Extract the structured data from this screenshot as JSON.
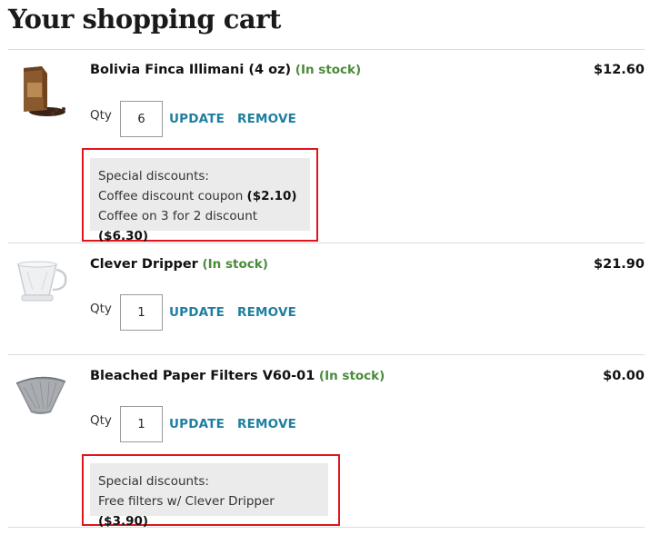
{
  "page": {
    "title": "Your shopping cart"
  },
  "cart": {
    "qty_label": "Qty",
    "update_label": "UPDATE",
    "remove_label": "REMOVE",
    "discount_heading": "Special discounts:",
    "items": [
      {
        "name": "Bolivia Finca Illimani (4 oz)",
        "stock": "(In stock)",
        "price": "$12.60",
        "qty": "6",
        "image_icon": "coffee-bag-icon",
        "discounts": [
          {
            "label": "Coffee discount coupon",
            "amount": "($2.10)"
          },
          {
            "label": "Coffee on 3 for 2 discount",
            "amount": "($6.30)"
          }
        ]
      },
      {
        "name": "Clever Dripper",
        "stock": "(In stock)",
        "price": "$21.90",
        "qty": "1",
        "image_icon": "coffee-dripper-icon",
        "discounts": []
      },
      {
        "name": "Bleached Paper Filters V60-01",
        "stock": "(In stock)",
        "price": "$0.00",
        "qty": "1",
        "image_icon": "paper-filter-icon",
        "discounts": [
          {
            "label": "Free filters w/ Clever Dripper",
            "amount": "($3.90)"
          }
        ]
      }
    ]
  },
  "colors": {
    "stock": "#4a8a3a",
    "link": "#1f7fa0",
    "highlight_border": "#e0161d",
    "discount_bg": "#ebebeb"
  }
}
